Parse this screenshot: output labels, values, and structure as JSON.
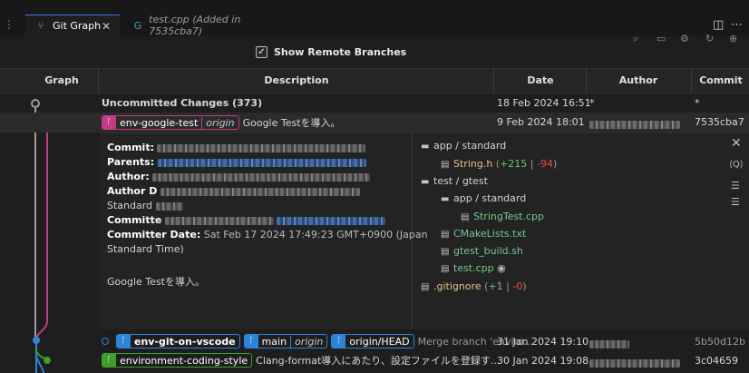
{
  "tabs": [
    {
      "label": "Git Graph",
      "active": true,
      "icon": "git-graph-icon"
    },
    {
      "label": "test.cpp (Added in 7535cba7)",
      "active": false,
      "icon": "cpp-file-icon"
    }
  ],
  "controls": {
    "show_remote_label": "Show Remote Branches",
    "show_remote_checked": true
  },
  "columns": {
    "graph": "Graph",
    "description": "Description",
    "date": "Date",
    "author": "Author",
    "commit": "Commit"
  },
  "rows": {
    "uncommitted": {
      "description": "Uncommitted Changes (373)",
      "date": "18 Feb 2024 16:51",
      "author": "*",
      "commit": "*"
    },
    "commit1": {
      "branch": "env-google-test",
      "remote": "origin",
      "message": "Google Testを導入。",
      "date": "9 Feb 2024 18:01",
      "commit": "7535cba7"
    },
    "commit2": {
      "branch": "env-git-on-vscode",
      "branch2": "main",
      "branch2_remote": "origin",
      "branch3": "origin/HEAD",
      "message": "Merge branch 'enviro...",
      "date": "31 Jan 2024 19:10",
      "commit": "5b50d12b"
    },
    "commit3": {
      "branch": "environment-coding-style",
      "message": "Clang-format導入にあたり、設定ファイルを登録す...",
      "date": "30 Jan 2024 19:08",
      "commit": "3c04659"
    }
  },
  "details": {
    "commit_label": "Commit:",
    "parents_label": "Parents:",
    "author_label": "Author:",
    "author_date_label": "Author D",
    "standard_text": "Standard",
    "committer_label": "Committe",
    "committer_date_label": "Committer Date:",
    "committer_date_value": "Sat Feb 17 2024 17:49:23 GMT+0900 (Japan",
    "standard_time": "Standard Time)",
    "message": "Google Testを導入。"
  },
  "files": {
    "dir1": "app / standard",
    "file1": "String.h",
    "file1_add": "+215",
    "file1_del": "-94",
    "dir2": "test / gtest",
    "dir3": "app / standard",
    "file2": "StringTest.cpp",
    "file3": "CMakeLists.txt",
    "file4": "gtest_build.sh",
    "file5": "test.cpp",
    "file6": ".gitignore",
    "file6_add": "+1",
    "file6_del": "-0"
  },
  "colors": {
    "pink": "#c13b86",
    "blue": "#2c84d8",
    "green": "#3f9d2d",
    "accent": "#3a7bd5"
  }
}
